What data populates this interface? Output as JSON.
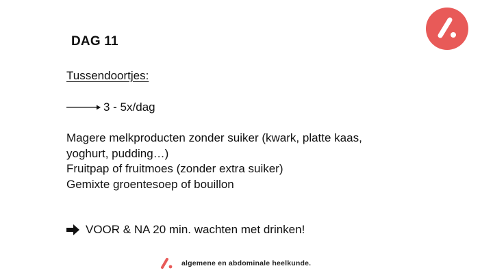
{
  "slide": {
    "title": "DAG 11",
    "subheading": "Tussendoortjes:",
    "frequency": "3 - 5x/dag",
    "items": [
      "Magere melkproducten zonder suiker (kwark, platte kaas,",
      "yoghurt, pudding…)",
      "Fruitpap of fruitmoes (zonder extra suiker)",
      "Gemixte groentesoep of bouillon"
    ],
    "warning": "VOOR & NA 20 min. wachten met drinken!"
  },
  "footer": {
    "text": "algemene en abdominale heelkunde."
  },
  "icons": {
    "logo": "slash-dot-logo-icon",
    "frequency_arrow": "long-right-arrow-icon",
    "warning_arrow": "bold-right-arrow-icon"
  },
  "colors": {
    "brand": "#e85a58",
    "text": "#111111"
  }
}
